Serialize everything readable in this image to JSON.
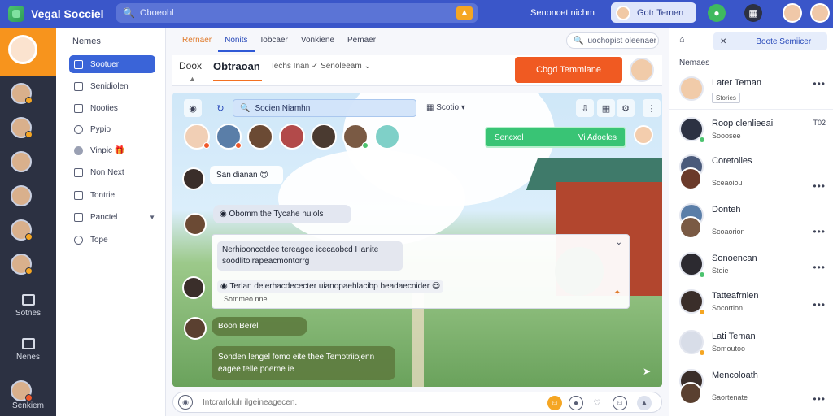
{
  "app": {
    "title": "Vegal Socciel"
  },
  "top": {
    "search_text": "Oboeohl",
    "status_text": "Senoncet nichm",
    "user_chip": "Gotr Temen"
  },
  "rail": {
    "btn1_label": "Sotnes",
    "btn2_label": "Nenes",
    "btn3_label": "Senkiem"
  },
  "nav": {
    "title": "Nemes",
    "items": [
      {
        "label": "Sootuer",
        "icon": "home-icon"
      },
      {
        "label": "Senidiolen",
        "icon": "document-icon"
      },
      {
        "label": "Nooties",
        "icon": "bookmark-icon"
      },
      {
        "label": "Pypio",
        "icon": "clock-icon"
      },
      {
        "label": "Vinpic 🎁",
        "icon": "circle-icon"
      },
      {
        "label": "Non Next",
        "icon": "grid-icon"
      },
      {
        "label": "Tontrie",
        "icon": "flag-icon"
      },
      {
        "label": "Panctel",
        "icon": "image-icon"
      },
      {
        "label": "Tope",
        "icon": "info-icon"
      }
    ]
  },
  "tabs": [
    {
      "label": "Rernaer"
    },
    {
      "label": "Nonits"
    },
    {
      "label": "Iobcaer"
    },
    {
      "label": "Vonkiene"
    },
    {
      "label": "Pemaer"
    }
  ],
  "filter_placeholder": "uochopist oleenaer",
  "chat": {
    "left_label": "Doox",
    "left_sub": "|",
    "name": "Obtraoan",
    "status": "Iechs Inan ✓ Senoleeam",
    "cta": "Cbgd Temmlane",
    "toolbar_search": "Socien Niamhn",
    "toolbar_sort": "Scotio"
  },
  "banner": {
    "left": "Sencxol",
    "right": "Vi Adoeles"
  },
  "messages": {
    "m1": "San dianan 😊",
    "m2": "Obomm the Tycahe nuiols",
    "panel_line1": "Nerhiooncetdee tereagee icecaobcd Hanite",
    "panel_line2": "soodlitoirapeacmontorrg",
    "panel_line3": "Terlan deierhacdececter uianopaehlacibp beadaecnider 😍",
    "panel_line4": "Sotnmeo nne",
    "m3": "Boon Berel",
    "m4_line1": "Sonden lengel fomo eite thee Temotriiojenn",
    "m4_line2": "eagee telle poerne ie"
  },
  "composer": {
    "placeholder": "Intcrarlclulr ilgeineagecen."
  },
  "right": {
    "search_label": "Boote Semiicer",
    "title": "Nemaes",
    "contacts": [
      {
        "name": "Later Teman",
        "sub": "Stories",
        "time": ""
      },
      {
        "name": "Roop clenlieeail",
        "sub": "Sooosee",
        "time": "T02"
      },
      {
        "name": "Coretoiles",
        "sub": "Sceaoiou",
        "time": ""
      },
      {
        "name": "Donteh",
        "sub": "Scoaorion",
        "time": ""
      },
      {
        "name": "Sonoencan",
        "sub": "Stoie",
        "time": ""
      },
      {
        "name": "Tatteafrnien",
        "sub": "Socortlon",
        "time": ""
      },
      {
        "name": "Lati Teman",
        "sub": "Somoutoo",
        "time": ""
      },
      {
        "name": "Mencoloath",
        "sub": "Saortenate",
        "time": ""
      }
    ]
  }
}
